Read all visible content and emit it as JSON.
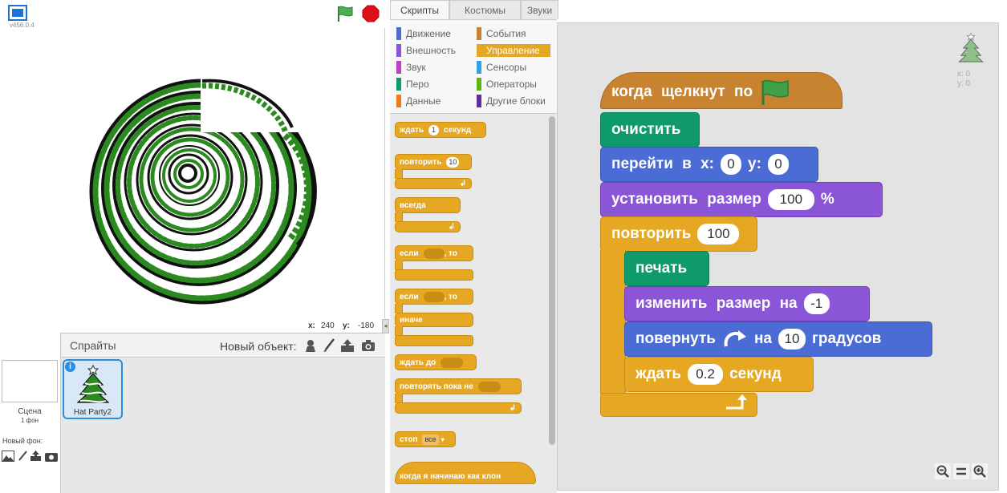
{
  "stage": {
    "version": "v456.0.4",
    "coords": {
      "x_label": "x:",
      "x": "240",
      "y_label": "y:",
      "y": "-180"
    }
  },
  "sprites": {
    "title": "Спрайты",
    "new_object_label": "Новый объект:",
    "scene_label": "Сцена",
    "scene_count": "1 фон",
    "new_backdrop_label": "Новый фон:",
    "sprite_name": "Hat Party2"
  },
  "tabs": [
    "Скрипты",
    "Костюмы",
    "Звуки"
  ],
  "categories": {
    "left": [
      {
        "label": "Движение",
        "color": "#4a6cd4"
      },
      {
        "label": "Внешность",
        "color": "#8a55d7"
      },
      {
        "label": "Звук",
        "color": "#bb42c3"
      },
      {
        "label": "Перо",
        "color": "#0e9a6c"
      },
      {
        "label": "Данные",
        "color": "#ee7d16"
      }
    ],
    "right": [
      {
        "label": "События",
        "color": "#c88330"
      },
      {
        "label": "Управление",
        "color": "#e6a822"
      },
      {
        "label": "Сенсоры",
        "color": "#2ca5e2"
      },
      {
        "label": "Операторы",
        "color": "#5cb712"
      },
      {
        "label": "Другие блоки",
        "color": "#632d99"
      }
    ]
  },
  "palette": {
    "wait": "ждать",
    "wait_val": "1",
    "wait_unit": "секунд",
    "repeat": "повторить",
    "repeat_val": "10",
    "forever": "всегда",
    "if": "если",
    "then": ", то",
    "if2": "если",
    "then2": ", то",
    "else": "иначе",
    "wait_until": "ждать до",
    "repeat_until": "повторять пока не",
    "stop": "стоп",
    "stop_val": "все",
    "clone_start": "когда я начинаю как клон"
  },
  "script": {
    "hat": "когда щелкнут по",
    "clear": "очистить",
    "goto": "перейти в х:",
    "goto_x": "0",
    "goto_y_label": "y:",
    "goto_y": "0",
    "set_size": "установить размер",
    "set_size_val": "100",
    "percent": "%",
    "repeat": "повторить",
    "repeat_val": "100",
    "stamp": "печать",
    "change_size": "изменить размер на",
    "change_size_val": "-1",
    "turn": "повернуть",
    "turn_on": "на",
    "turn_val": "10",
    "degrees": "градусов",
    "wait": "ждать",
    "wait_val": "0.2",
    "wait_unit": "секунд"
  },
  "sprite_info": {
    "x": "x: 0",
    "y": "y: 0"
  }
}
